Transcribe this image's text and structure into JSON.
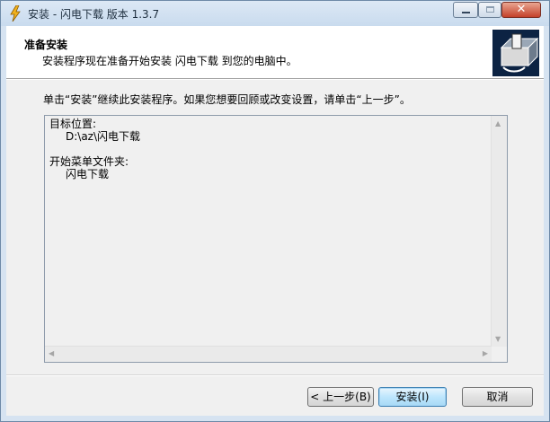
{
  "window": {
    "title": "安装 - 闪电下载 版本 1.3.7",
    "close_glyph": "✕"
  },
  "header": {
    "title": "准备安装",
    "subtitle": "安装程序现在准备开始安装 闪电下载 到您的电脑中。"
  },
  "instruction": "单击“安装”继续此安装程序。如果您想要回顾或改变设置，请单击“上一步”。",
  "memo": {
    "lines": [
      {
        "text": "目标位置:",
        "indent": false
      },
      {
        "text": "D:\\az\\闪电下载",
        "indent": true
      },
      {
        "text": "",
        "indent": false
      },
      {
        "text": "开始菜单文件夹:",
        "indent": false
      },
      {
        "text": "闪电下载",
        "indent": true
      }
    ]
  },
  "scroll": {
    "up": "▲",
    "down": "▼",
    "left": "◀",
    "right": "▶"
  },
  "buttons": {
    "back": "< 上一步(B)",
    "install": "安装(I)",
    "cancel": "取消"
  },
  "icons": {
    "app": "lightning-icon",
    "wizard": "installer-box-icon"
  },
  "colors": {
    "accent": "#3c7fb1",
    "wizard_bg": "#0c2343"
  }
}
